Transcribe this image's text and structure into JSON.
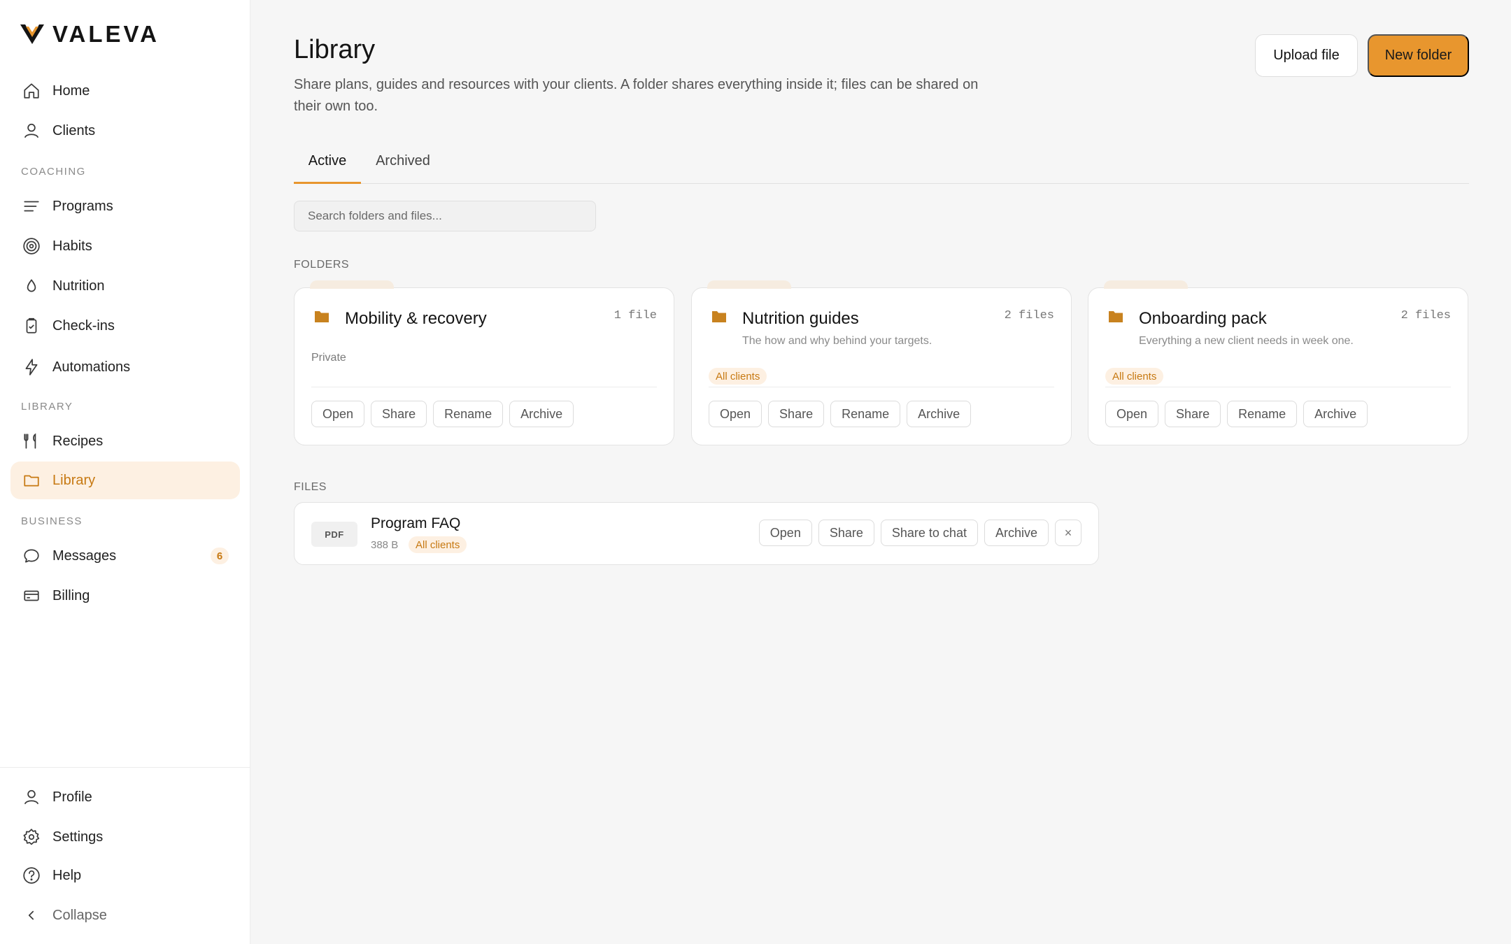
{
  "app": {
    "name": "VALEVA"
  },
  "sidebar": {
    "nav": [
      {
        "label": "Home",
        "icon": "home-icon"
      },
      {
        "label": "Clients",
        "icon": "user-icon"
      },
      {
        "label": "Programs",
        "icon": "list-icon"
      },
      {
        "label": "Habits",
        "icon": "target-icon"
      },
      {
        "label": "Nutrition",
        "icon": "droplet-icon"
      },
      {
        "label": "Check-ins",
        "icon": "clipboard-check-icon"
      },
      {
        "label": "Automations",
        "icon": "bolt-icon"
      },
      {
        "label": "Recipes",
        "icon": "utensils-icon"
      },
      {
        "label": "Library",
        "icon": "folder-icon",
        "active": true
      },
      {
        "label": "Messages",
        "icon": "chat-icon",
        "badge": "6"
      },
      {
        "label": "Billing",
        "icon": "credit-card-icon"
      }
    ],
    "sections": {
      "coaching": "COACHING",
      "library": "LIBRARY",
      "business": "BUSINESS"
    },
    "footer": [
      {
        "label": "Profile",
        "icon": "user-icon"
      },
      {
        "label": "Settings",
        "icon": "gear-icon"
      },
      {
        "label": "Help",
        "icon": "help-circle-icon"
      },
      {
        "label": "Collapse",
        "icon": "chevron-left-icon"
      }
    ]
  },
  "header": {
    "title": "Library",
    "subtitle": "Share plans, guides and resources with your clients. A folder shares everything inside it; files can be shared on their own too.",
    "upload_label": "Upload file",
    "new_folder_label": "New folder"
  },
  "tabs": [
    {
      "label": "Active",
      "active": true
    },
    {
      "label": "Archived",
      "active": false
    }
  ],
  "search": {
    "placeholder": "Search folders and files..."
  },
  "folders_heading": "FOLDERS",
  "folders": [
    {
      "name": "Mobility & recovery",
      "count": "1 file",
      "description": "",
      "visibility": "Private"
    },
    {
      "name": "Nutrition guides",
      "count": "2 files",
      "description": "The how and why behind your targets.",
      "visibility": "All clients"
    },
    {
      "name": "Onboarding pack",
      "count": "2 files",
      "description": "Everything a new client needs in week one.",
      "visibility": "All clients"
    }
  ],
  "folder_actions": {
    "open": "Open",
    "share": "Share",
    "rename": "Rename",
    "archive": "Archive"
  },
  "files_heading": "FILES",
  "files": [
    {
      "type": "PDF",
      "name": "Program FAQ",
      "size": "388 B",
      "visibility": "All clients",
      "actions": {
        "open": "Open",
        "share": "Share",
        "share_chat": "Share to chat",
        "archive": "Archive",
        "remove": "×"
      }
    }
  ],
  "colors": {
    "accent": "#e8962e",
    "accent_text": "#c77912",
    "accent_soft": "#fdf0e2"
  }
}
